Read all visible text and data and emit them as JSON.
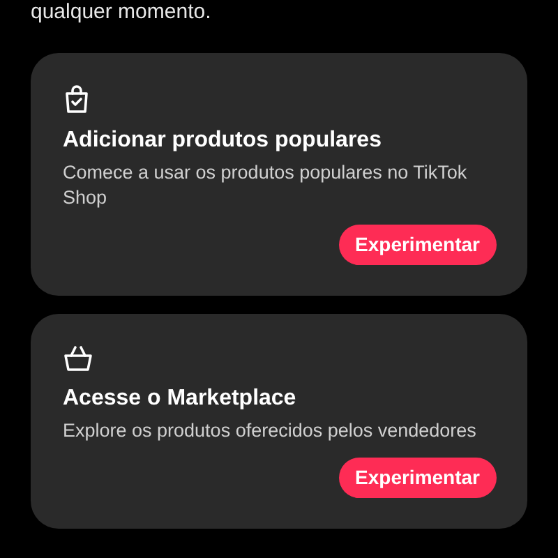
{
  "intro": "qualquer momento.",
  "cards": [
    {
      "title": "Adicionar produtos populares",
      "description": "Comece a usar os produtos populares no TikTok Shop",
      "button": "Experimentar"
    },
    {
      "title": "Acesse o Marketplace",
      "description": "Explore os produtos oferecidos pelos vendedores",
      "button": "Experimentar"
    }
  ]
}
